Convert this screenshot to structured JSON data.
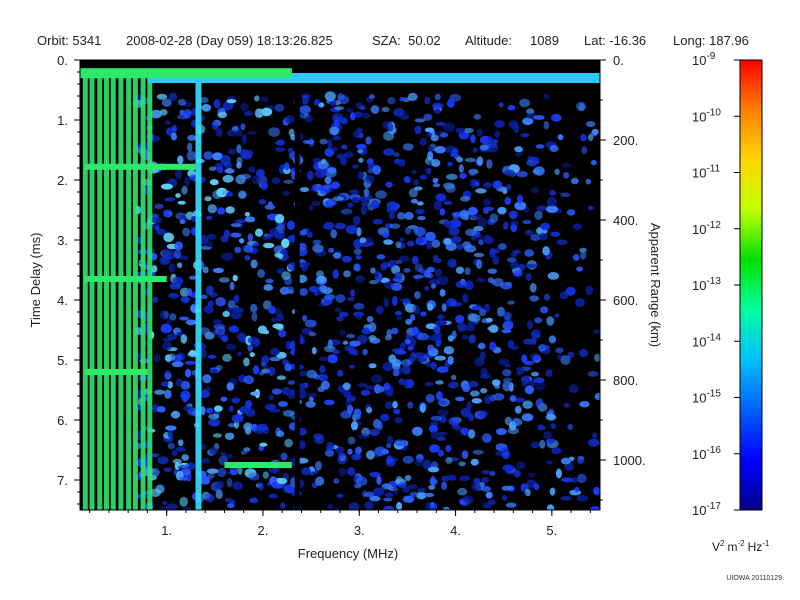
{
  "header": {
    "orbit": "Orbit: 5341",
    "datetime": "2008-02-28 (Day 059) 18:13:26.825",
    "sza": "SZA:  50.02",
    "altitude": "Altitude:     1089",
    "lat": "Lat: -16.36",
    "long": "Long: 187.96"
  },
  "chart_data": {
    "type": "heatmap",
    "xlabel": "Frequency (MHz)",
    "ylabel": "Time Delay (ms)",
    "y2label": "Apparent Range (km)",
    "xlim": [
      0.1,
      5.5
    ],
    "ylim": [
      0,
      7.5
    ],
    "xticks": [
      {
        "value": 1,
        "label": "1."
      },
      {
        "value": 2,
        "label": "2."
      },
      {
        "value": 3,
        "label": "3."
      },
      {
        "value": 4,
        "label": "4."
      },
      {
        "value": 5,
        "label": "5."
      }
    ],
    "yticks": [
      {
        "value": 0,
        "label": "0."
      },
      {
        "value": 1,
        "label": "1."
      },
      {
        "value": 2,
        "label": "2."
      },
      {
        "value": 3,
        "label": "3."
      },
      {
        "value": 4,
        "label": "4."
      },
      {
        "value": 5,
        "label": "5."
      },
      {
        "value": 6,
        "label": "6."
      },
      {
        "value": 7,
        "label": "7."
      }
    ],
    "y2ticks": [
      {
        "value": 0,
        "label": "0."
      },
      {
        "value": 200,
        "label": "200."
      },
      {
        "value": 400,
        "label": "400."
      },
      {
        "value": 600,
        "label": "600."
      },
      {
        "value": 800,
        "label": "800."
      },
      {
        "value": 1000,
        "label": "1000."
      }
    ],
    "y2lim": [
      0,
      1125
    ],
    "colorbar": {
      "scale": "log",
      "range_exponent": [
        -17,
        -9
      ],
      "ticks": [
        {
          "value": -9,
          "base": "10",
          "exp": "-9"
        },
        {
          "value": -10,
          "base": "10",
          "exp": "-10"
        },
        {
          "value": -11,
          "base": "10",
          "exp": "-11"
        },
        {
          "value": -12,
          "base": "10",
          "exp": "-12"
        },
        {
          "value": -13,
          "base": "10",
          "exp": "-13"
        },
        {
          "value": -14,
          "base": "10",
          "exp": "-14"
        },
        {
          "value": -15,
          "base": "10",
          "exp": "-15"
        },
        {
          "value": -16,
          "base": "10",
          "exp": "-16"
        },
        {
          "value": -17,
          "base": "10",
          "exp": "-17"
        }
      ],
      "colors": [
        "#00008b",
        "#0000ff",
        "#0060ff",
        "#00c0ff",
        "#00ffa0",
        "#00e000",
        "#c0ff00",
        "#ffd700",
        "#ff8000",
        "#ff0000"
      ],
      "unit": [
        "V",
        "2",
        "m",
        "-2",
        "Hz",
        "-1"
      ]
    },
    "features": {
      "surface_echo_delay_ms": 0.3,
      "surface_echo_color": "#2ec8ff",
      "strong_lines_mhz": [
        0.15,
        0.22,
        0.3,
        0.37,
        0.44,
        0.52,
        0.6,
        0.67,
        0.75,
        0.82,
        1.32
      ],
      "background": "#000000",
      "noise_color": "#1a3cff"
    }
  },
  "footnote": "UIOWA 20110129"
}
